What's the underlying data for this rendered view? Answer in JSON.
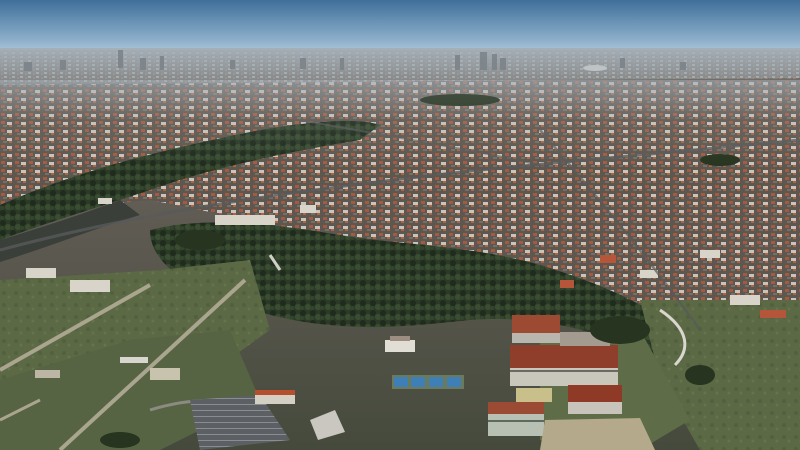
{
  "scene": {
    "description_visible_text": [],
    "colors": {
      "sky_top": "#3f6f9a",
      "sky_horizon": "#b9cfe0",
      "haze": "#9aa6ad",
      "city_far": "#7c8079",
      "city_mid": "#6d655c",
      "roof_red": "#b0573a",
      "roof_white": "#d9d6cf",
      "tree_dark": "#243322",
      "tree_mid": "#34472c",
      "grass": "#5d6b45",
      "grass_light": "#7c8560",
      "path": "#a9a58f",
      "parking": "#5f6367",
      "court_blue": "#3f7fb8"
    }
  }
}
